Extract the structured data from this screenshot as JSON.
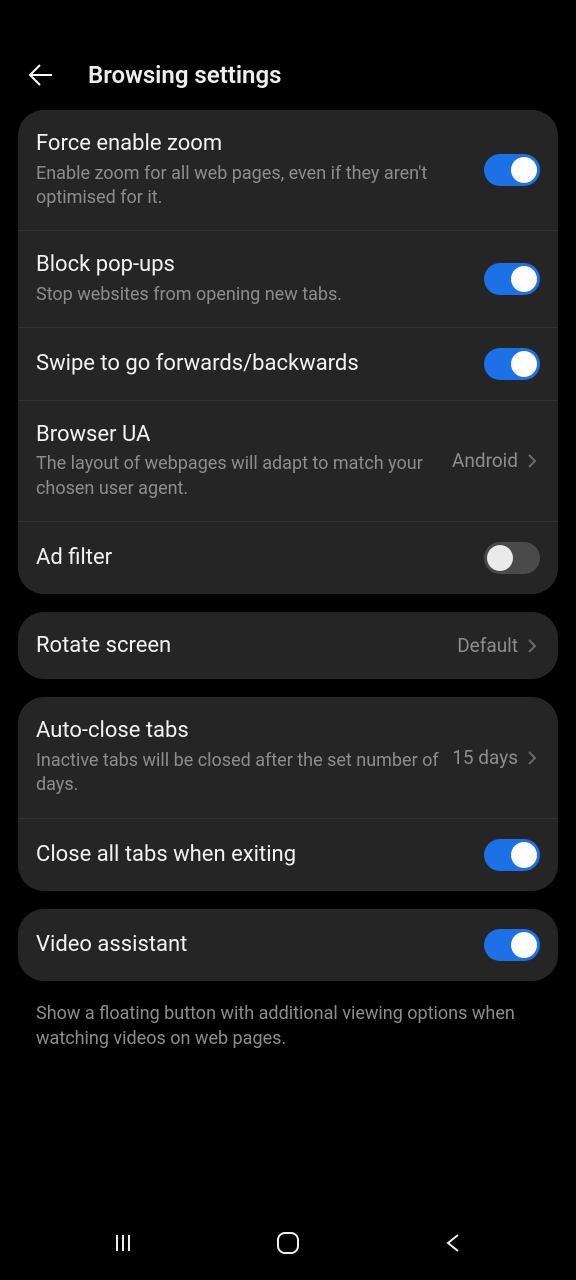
{
  "header": {
    "title": "Browsing settings"
  },
  "group1": {
    "force_zoom": {
      "title": "Force enable zoom",
      "sub": "Enable zoom for all web pages, even if they aren't optimised for it.",
      "on": true
    },
    "block_popups": {
      "title": "Block pop-ups",
      "sub": "Stop websites from opening new tabs.",
      "on": true
    },
    "swipe_nav": {
      "title": "Swipe to go forwards/backwards",
      "on": true
    },
    "browser_ua": {
      "title": "Browser UA",
      "sub": "The layout of webpages will adapt to match your chosen user agent.",
      "value": "Android"
    },
    "ad_filter": {
      "title": "Ad filter",
      "on": false
    }
  },
  "group2": {
    "rotate_screen": {
      "title": "Rotate screen",
      "value": "Default"
    }
  },
  "group3": {
    "auto_close": {
      "title": "Auto-close tabs",
      "sub": "Inactive tabs will be closed after the set number of days.",
      "value": "15 days"
    },
    "close_all_exit": {
      "title": "Close all tabs when exiting",
      "on": true
    }
  },
  "group4": {
    "video_assistant": {
      "title": "Video assistant",
      "on": true
    },
    "footer": "Show a floating button with additional viewing options when watching videos on web pages."
  }
}
